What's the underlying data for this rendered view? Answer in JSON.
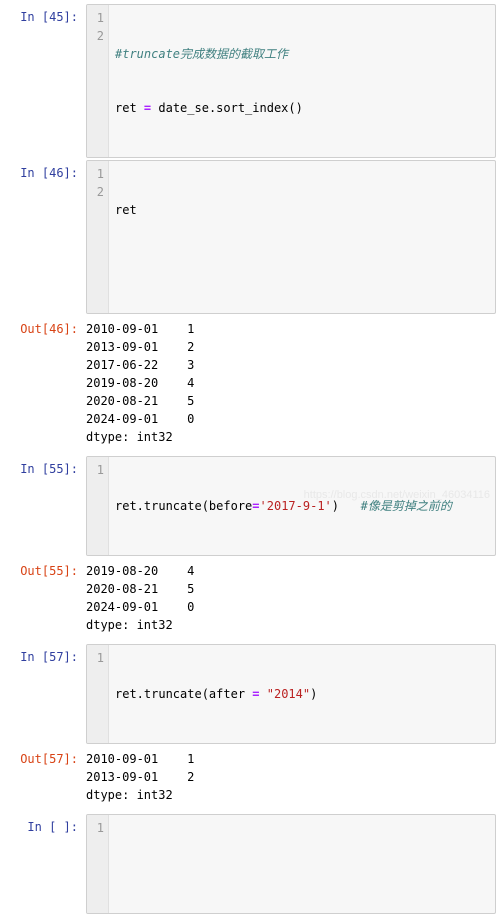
{
  "cells": [
    {
      "kind": "in",
      "n": "45",
      "gutter": [
        "1",
        "2"
      ],
      "code": {
        "line1_comment": "#truncate完成数据的截取工作",
        "line2_lhs": "ret ",
        "line2_op": "=",
        "line2_rhs": " date_se.sort_index()"
      }
    },
    {
      "kind": "in",
      "n": "46",
      "gutter": [
        "1",
        "2"
      ],
      "code": {
        "line1": "ret",
        "line2": " "
      }
    },
    {
      "kind": "out",
      "n": "46",
      "text": "2010-09-01    1\n2013-09-01    2\n2017-06-22    3\n2019-08-20    4\n2020-08-21    5\n2024-09-01    0\ndtype: int32"
    },
    {
      "kind": "in",
      "n": "55",
      "gutter": [
        "1"
      ],
      "code": {
        "pre": "ret.truncate(before",
        "op": "=",
        "str": "'2017-9-1'",
        "post": ")   ",
        "comment": "#像是剪掉之前的"
      }
    },
    {
      "kind": "out",
      "n": "55",
      "text": "2019-08-20    4\n2020-08-21    5\n2024-09-01    0\ndtype: int32"
    },
    {
      "kind": "in",
      "n": "57",
      "gutter": [
        "1"
      ],
      "code": {
        "pre": "ret.truncate(after ",
        "op": "=",
        "mid": " ",
        "str": "\"2014\"",
        "post": ")"
      }
    },
    {
      "kind": "out",
      "n": "57",
      "text": "2010-09-01    1\n2013-09-01    2\ndtype: int32"
    },
    {
      "kind": "in",
      "n": " ",
      "gutter": [
        "1"
      ],
      "code": {
        "line1": " "
      }
    }
  ],
  "watermark": "https://blog.csdn.net/weixin_46034116"
}
